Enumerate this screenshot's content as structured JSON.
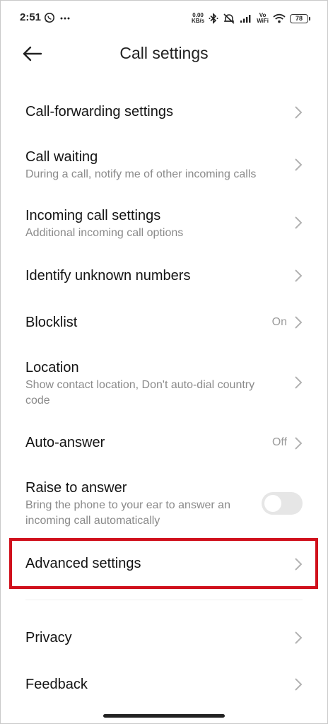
{
  "status_bar": {
    "time": "2:51",
    "net_speed_value": "0.00",
    "net_speed_unit": "KB/s",
    "vowifi_top": "Vo",
    "vowifi_bottom": "WiFi",
    "battery": "78",
    "icons": [
      "whatsapp-icon",
      "more-dots-icon",
      "bluetooth-icon",
      "mute-icon",
      "signal-icon",
      "wifi-icon",
      "battery-icon"
    ]
  },
  "header": {
    "title": "Call settings",
    "back_icon": "back-arrow-icon"
  },
  "rows": [
    {
      "id": "call-forwarding",
      "title": "Call-forwarding settings"
    },
    {
      "id": "call-waiting",
      "title": "Call waiting",
      "subtitle": "During a call, notify me of other incoming calls"
    },
    {
      "id": "incoming-call",
      "title": "Incoming call settings",
      "subtitle": "Additional incoming call options"
    },
    {
      "id": "identify-unknown",
      "title": "Identify unknown numbers"
    },
    {
      "id": "blocklist",
      "title": "Blocklist",
      "value": "On"
    },
    {
      "id": "location",
      "title": "Location",
      "subtitle": "Show contact location, Don't auto-dial country code"
    },
    {
      "id": "auto-answer",
      "title": "Auto-answer",
      "value": "Off"
    },
    {
      "id": "raise-to-answer",
      "title": "Raise to answer",
      "subtitle": "Bring the phone to your ear to answer an incoming call automatically",
      "toggle": "off"
    },
    {
      "id": "advanced",
      "title": "Advanced settings"
    },
    {
      "id": "privacy",
      "title": "Privacy"
    },
    {
      "id": "feedback",
      "title": "Feedback"
    }
  ],
  "colors": {
    "highlight": "#d0101c",
    "subtitle": "#8a8a8a",
    "toggle_off": "#e6e6e6"
  }
}
